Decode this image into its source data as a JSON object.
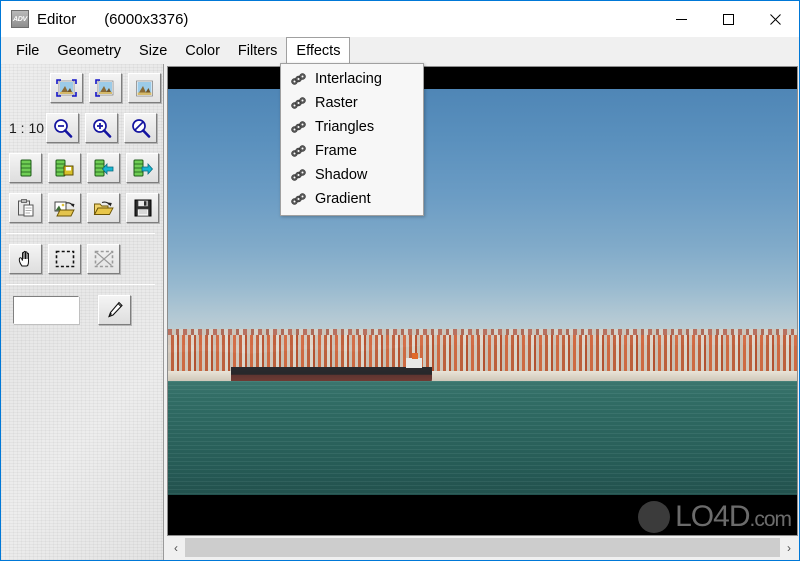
{
  "window": {
    "app_icon_label": "ADV",
    "title": "Editor",
    "dimensions": "(6000x3376)",
    "minimize_label": "Minimize",
    "maximize_label": "Maximize",
    "close_label": "Close"
  },
  "menubar": {
    "items": [
      {
        "label": "File",
        "open": false
      },
      {
        "label": "Geometry",
        "open": false
      },
      {
        "label": "Size",
        "open": false
      },
      {
        "label": "Color",
        "open": false
      },
      {
        "label": "Filters",
        "open": false
      },
      {
        "label": "Effects",
        "open": true
      }
    ]
  },
  "dropdown": {
    "owner": "Effects",
    "items": [
      {
        "label": "Interlacing",
        "icon": "gear-icon"
      },
      {
        "label": "Raster",
        "icon": "gear-icon"
      },
      {
        "label": "Triangles",
        "icon": "gear-icon"
      },
      {
        "label": "Frame",
        "icon": "gear-icon"
      },
      {
        "label": "Shadow",
        "icon": "gear-icon"
      },
      {
        "label": "Gradient",
        "icon": "gear-icon"
      }
    ]
  },
  "toolpanel": {
    "view_row": [
      {
        "name": "fit-to-window-button",
        "icon": "image-fit-icon"
      },
      {
        "name": "fit-width-button",
        "icon": "image-fit-corner-icon"
      },
      {
        "name": "actual-size-button",
        "icon": "image-plain-icon"
      }
    ],
    "zoom_ratio": "1 : 10",
    "zoom_row": [
      {
        "name": "zoom-out-button",
        "icon": "magnifier-minus-icon"
      },
      {
        "name": "zoom-in-button",
        "icon": "magnifier-plus-icon"
      },
      {
        "name": "zoom-reset-button",
        "icon": "magnifier-none-icon"
      }
    ],
    "buffer_row": [
      {
        "name": "buffer-button",
        "icon": "stack-icon"
      },
      {
        "name": "buffer-save-button",
        "icon": "stack-disk-icon"
      },
      {
        "name": "buffer-load-button",
        "icon": "stack-arrow-left-icon"
      },
      {
        "name": "buffer-store-button",
        "icon": "stack-arrow-right-icon"
      }
    ],
    "file_row": [
      {
        "name": "paste-button",
        "icon": "clipboard-icon"
      },
      {
        "name": "open-image-button",
        "icon": "folder-image-icon"
      },
      {
        "name": "open-folder-button",
        "icon": "folder-open-icon"
      },
      {
        "name": "save-button",
        "icon": "floppy-disk-icon"
      }
    ],
    "mode_row": [
      {
        "name": "pan-tool-button",
        "icon": "hand-icon",
        "active": true
      },
      {
        "name": "select-tool-button",
        "icon": "marquee-icon",
        "active": false
      },
      {
        "name": "crop-tool-button",
        "icon": "crop-icon",
        "active": false
      }
    ],
    "color_swatch": "#ffffff",
    "pen_tool": {
      "name": "pen-tool-button",
      "icon": "pencil-icon"
    }
  },
  "viewer": {
    "image_alt": "Lisbon waterfront panorama with cargo ship",
    "letterbox_color": "#000000",
    "watermark_text": "LO4D",
    "watermark_suffix": ".com",
    "scroll_left_glyph": "‹",
    "scroll_right_glyph": "›"
  },
  "colors": {
    "accent": "#0078d7",
    "panel": "#f0f0f0",
    "border": "#9a9a9a",
    "sky": "#5a90bd",
    "sea": "#2e6a63",
    "roof": "#c2603c"
  }
}
